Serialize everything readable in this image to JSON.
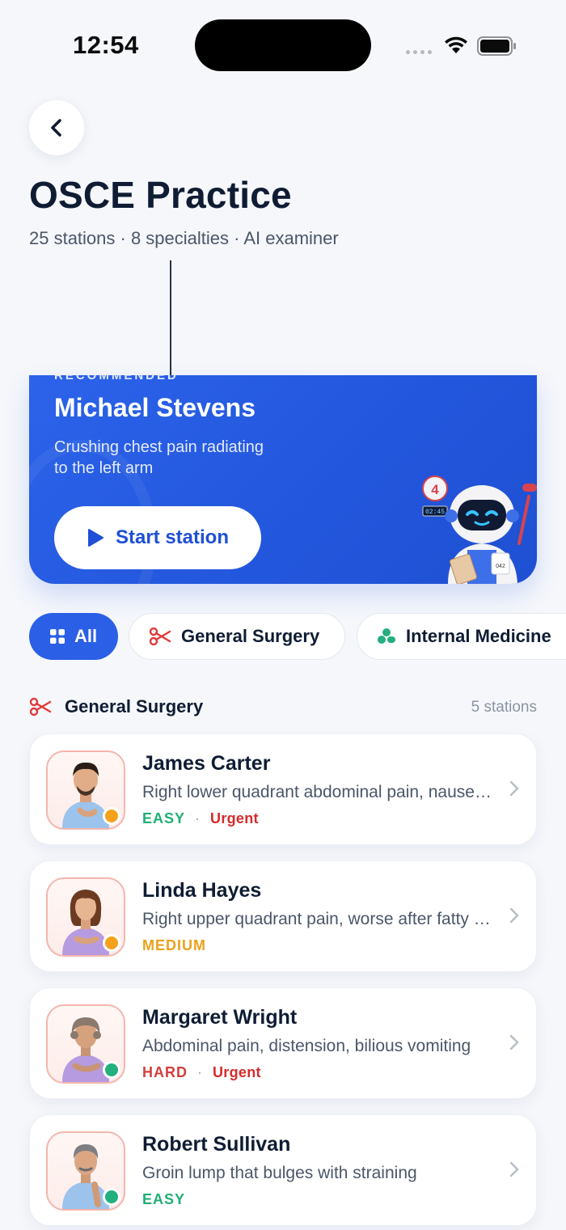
{
  "status_bar": {
    "time": "12:54"
  },
  "header": {
    "title": "OSCE Practice",
    "subtitle": "25 stations · 8 specialties · AI examiner"
  },
  "hero": {
    "eyebrow": "RECOMMENDED",
    "patient_name": "Michael Stevens",
    "complaint": "Crushing chest pain radiating to the left arm",
    "button_label": "Start station",
    "robot_badge": "4",
    "robot_timer": "02:45"
  },
  "filters": [
    {
      "label": "All",
      "icon": "grid-icon",
      "selected": true
    },
    {
      "label": "General Surgery",
      "icon": "scissors-icon",
      "selected": false
    },
    {
      "label": "Internal Medicine",
      "icon": "pills-icon",
      "selected": false
    }
  ],
  "section": {
    "title": "General Surgery",
    "icon": "scissors-icon",
    "count": "5 stations"
  },
  "stations": [
    {
      "name": "James Carter",
      "complaint": "Right lower quadrant abdominal pain, nausea and fever",
      "difficulty": "EASY",
      "urgent": "Urgent",
      "status_color": "#f4a21c"
    },
    {
      "name": "Linda Hayes",
      "complaint": "Right upper quadrant pain, worse after fatty meals",
      "difficulty": "MEDIUM",
      "urgent": "",
      "status_color": "#f4a21c"
    },
    {
      "name": "Margaret Wright",
      "complaint": "Abdominal pain, distension, bilious vomiting",
      "difficulty": "HARD",
      "urgent": "Urgent",
      "status_color": "#22b07d"
    },
    {
      "name": "Robert Sullivan",
      "complaint": "Groin lump that bulges with straining",
      "difficulty": "EASY",
      "urgent": "",
      "status_color": "#22b07d"
    }
  ],
  "colors": {
    "accent": "#2b5fe6",
    "easy": "#1fae74",
    "medium": "#e9a21a",
    "hard": "#d63d3d",
    "urgent": "#d62b2b"
  }
}
